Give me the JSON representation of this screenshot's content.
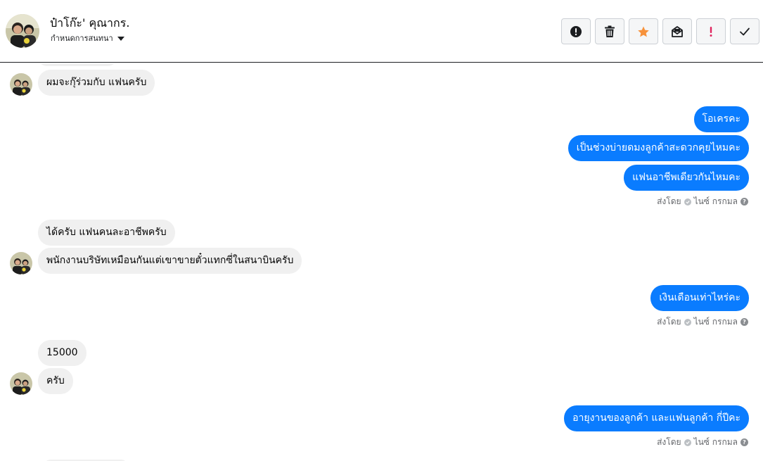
{
  "header": {
    "contact_name": "ป๋าโก๊ะ' คุณากร.",
    "conversation_settings": "กำหนดการสนทนา",
    "avatar_icon": "profile-photo",
    "toolbar": [
      {
        "name": "report-button",
        "icon": "alert-circle-icon",
        "color": "#1c1e21"
      },
      {
        "name": "delete-button",
        "icon": "trash-icon",
        "color": "#1c1e21"
      },
      {
        "name": "star-button",
        "icon": "star-icon",
        "color": "#f7923b"
      },
      {
        "name": "mark-unread-button",
        "icon": "envelope-icon",
        "color": "#1c1e21"
      },
      {
        "name": "priority-button",
        "icon": "exclamation-icon",
        "color": "#e0245e"
      },
      {
        "name": "done-button",
        "icon": "check-icon",
        "color": "#1c1e21"
      }
    ]
  },
  "messages": [
    {
      "side": "in",
      "text": "ผมจะกุ๊ร่วมกับ แฟนครับ",
      "avatar": true
    },
    {
      "side": "out",
      "text": "โอเครคะ"
    },
    {
      "side": "out",
      "text": "เป็นช่วงบ่ายดมงลูกค้าสะดวกคุยไหมคะ"
    },
    {
      "side": "out",
      "text": "แฟนอาชีพเดียวกันไหมคะ"
    },
    {
      "side": "in",
      "text": "ได้ครับ แฟนคนละอาชีพครับ"
    },
    {
      "side": "in",
      "text": "พนักงานบริษัทเหมือนกันแต่เขาขายตั๋วแทกซี่ในสนาบินครับ",
      "avatar": true
    },
    {
      "side": "out",
      "text": "เงินเดือนเท่าไหร่คะ"
    },
    {
      "side": "in",
      "text": "15000"
    },
    {
      "side": "in",
      "text": "ครับ",
      "avatar": true
    },
    {
      "side": "out",
      "text": "อายุงานของลูกค้า และแฟนลูกค้า กี่ปีคะ"
    }
  ],
  "sent_by": {
    "prefix": "ส่งโดย",
    "agent": "ไนซ์ กรกมล"
  },
  "colors": {
    "outgoing_bubble": "#0a7cff",
    "incoming_bubble": "#f0f0f0"
  }
}
